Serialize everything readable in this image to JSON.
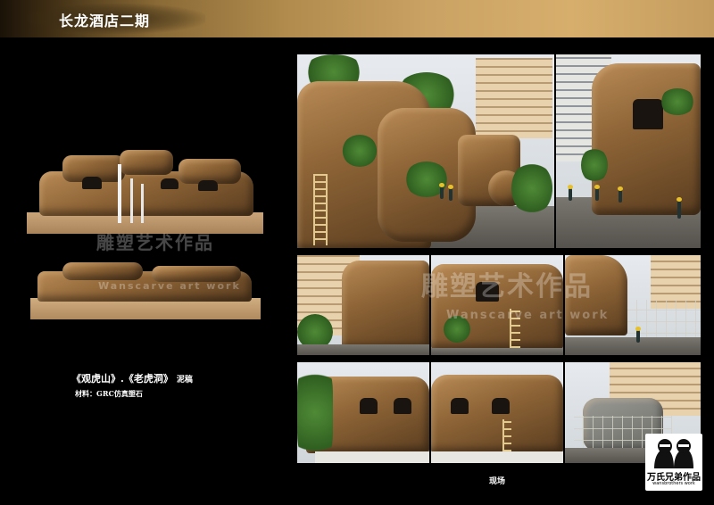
{
  "header": {
    "title": "长龙酒店二期"
  },
  "caption": {
    "title": "《观虎山》.《老虎洞》",
    "title_suffix": "泥稿",
    "material": "材料：GRC仿真塑石",
    "site_label": "现场"
  },
  "watermark": {
    "studio_cn": "雕塑艺术作品",
    "studio_en": "Wanscarve art work"
  },
  "brand": {
    "name": "万氏兄弟作品",
    "sub": "wansbrothers work"
  },
  "colors": {
    "background": "#000000",
    "header_gold": "#c9a263",
    "rock_brown": "#8b6235"
  }
}
